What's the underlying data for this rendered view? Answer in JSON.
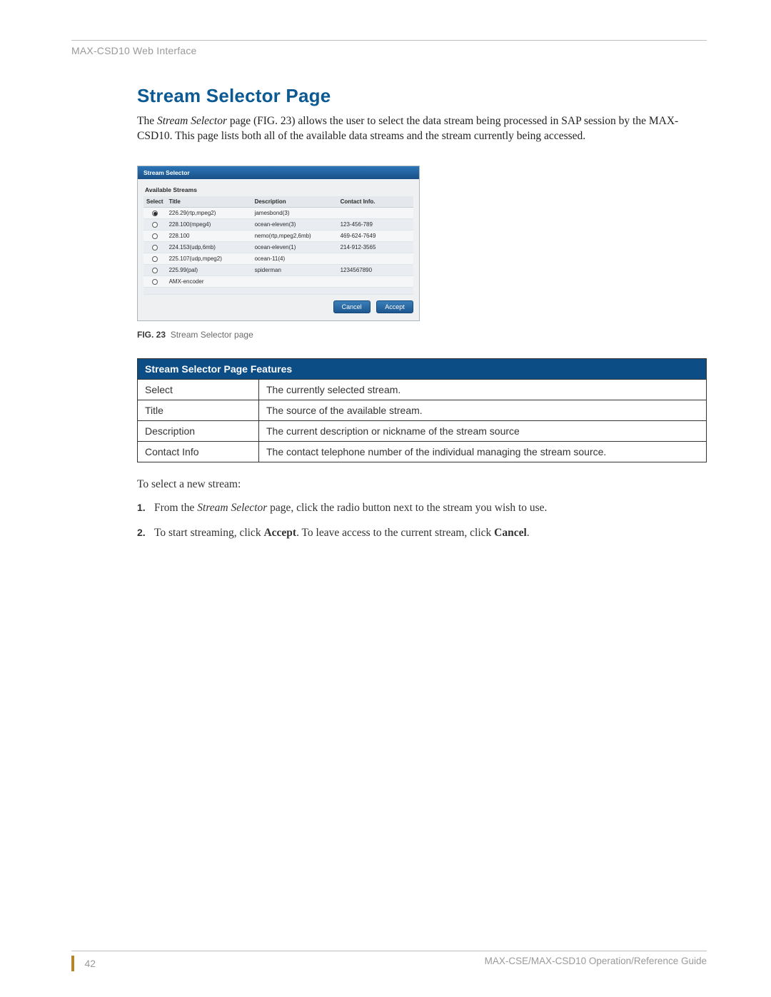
{
  "header": {
    "label": "MAX-CSD10 Web Interface"
  },
  "title": "Stream Selector Page",
  "intro": {
    "pre": "The ",
    "em": "Stream Selector",
    "post": " page (FIG. 23) allows the user to select the data stream being processed in SAP session by the MAX-CSD10. This page lists both all of the available data streams and the stream currently being accessed."
  },
  "screenshot": {
    "panel_title": "Stream Selector",
    "sub_heading": "Available Streams",
    "columns": {
      "select": "Select",
      "title": "Title",
      "description": "Description",
      "contact": "Contact Info."
    },
    "rows": [
      {
        "selected": true,
        "title": "226.29(rtp,mpeg2)",
        "description": "jamesbond(3)",
        "contact": ""
      },
      {
        "selected": false,
        "title": "228.100(mpeg4)",
        "description": "ocean-eleven(3)",
        "contact": "123-456-789"
      },
      {
        "selected": false,
        "title": "228.100",
        "description": "nemo(rtp,mpeg2,6mb)",
        "contact": "469-624-7649"
      },
      {
        "selected": false,
        "title": "224.153(udp,6mb)",
        "description": "ocean-eleven(1)",
        "contact": "214-912-3565"
      },
      {
        "selected": false,
        "title": "225.107(udp,mpeg2)",
        "description": "ocean-11(4)",
        "contact": ""
      },
      {
        "selected": false,
        "title": "225.99(pal)",
        "description": "spiderman",
        "contact": "1234567890"
      },
      {
        "selected": false,
        "title": "AMX-encoder",
        "description": "",
        "contact": ""
      }
    ],
    "buttons": {
      "cancel": "Cancel",
      "accept": "Accept"
    }
  },
  "caption": {
    "fig": "FIG. 23",
    "text": "Stream Selector page"
  },
  "features": {
    "heading": "Stream Selector Page Features",
    "rows": [
      {
        "k": "Select",
        "v": "The currently selected stream."
      },
      {
        "k": "Title",
        "v": "The source of the available stream."
      },
      {
        "k": "Description",
        "v": "The current description or nickname of the stream source"
      },
      {
        "k": "Contact Info",
        "v": "The contact telephone number of the individual managing the stream source."
      }
    ]
  },
  "lead": "To select a new stream:",
  "steps": [
    {
      "n": "1.",
      "pre": "From the ",
      "em": "Stream Selector",
      "post": " page, click the radio button next to the stream you wish to use."
    },
    {
      "n": "2.",
      "pre": "To start streaming, click ",
      "b1": "Accept",
      "mid": ". To leave access to the current stream, click ",
      "b2": "Cancel",
      "post2": "."
    }
  ],
  "footer": {
    "page": "42",
    "guide": "MAX-CSE/MAX-CSD10 Operation/Reference Guide"
  }
}
